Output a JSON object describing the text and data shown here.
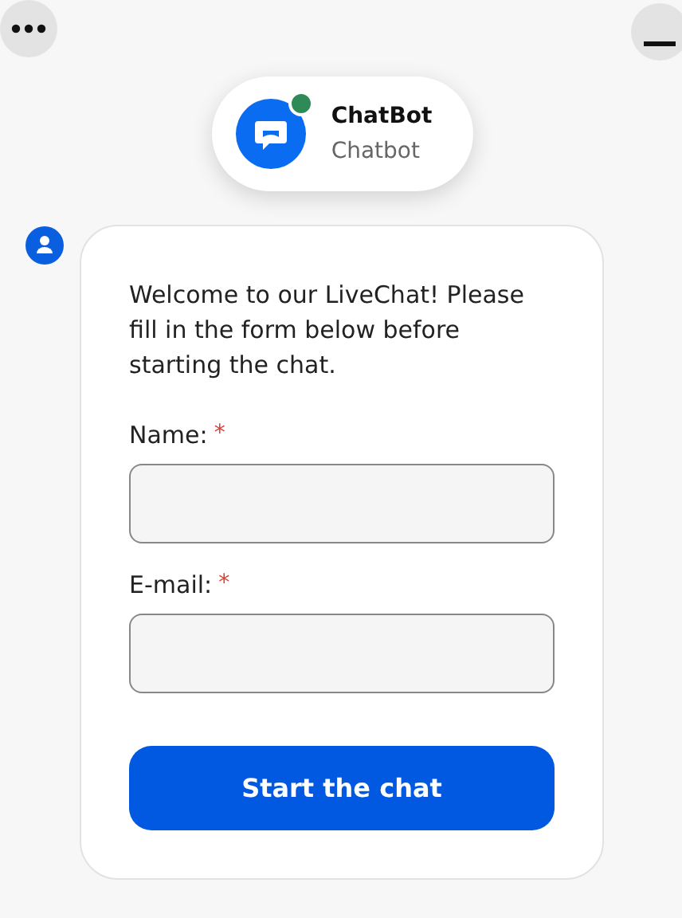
{
  "agent": {
    "name": "ChatBot",
    "role": "Chatbot",
    "online": true
  },
  "message": {
    "text": "Welcome to our LiveChat! Please fill in the form below before starting the chat."
  },
  "fields": [
    {
      "label": "Name:",
      "required_mark": "*"
    },
    {
      "label": "E-mail:",
      "required_mark": "*"
    }
  ],
  "submit": {
    "label": "Start the chat"
  }
}
